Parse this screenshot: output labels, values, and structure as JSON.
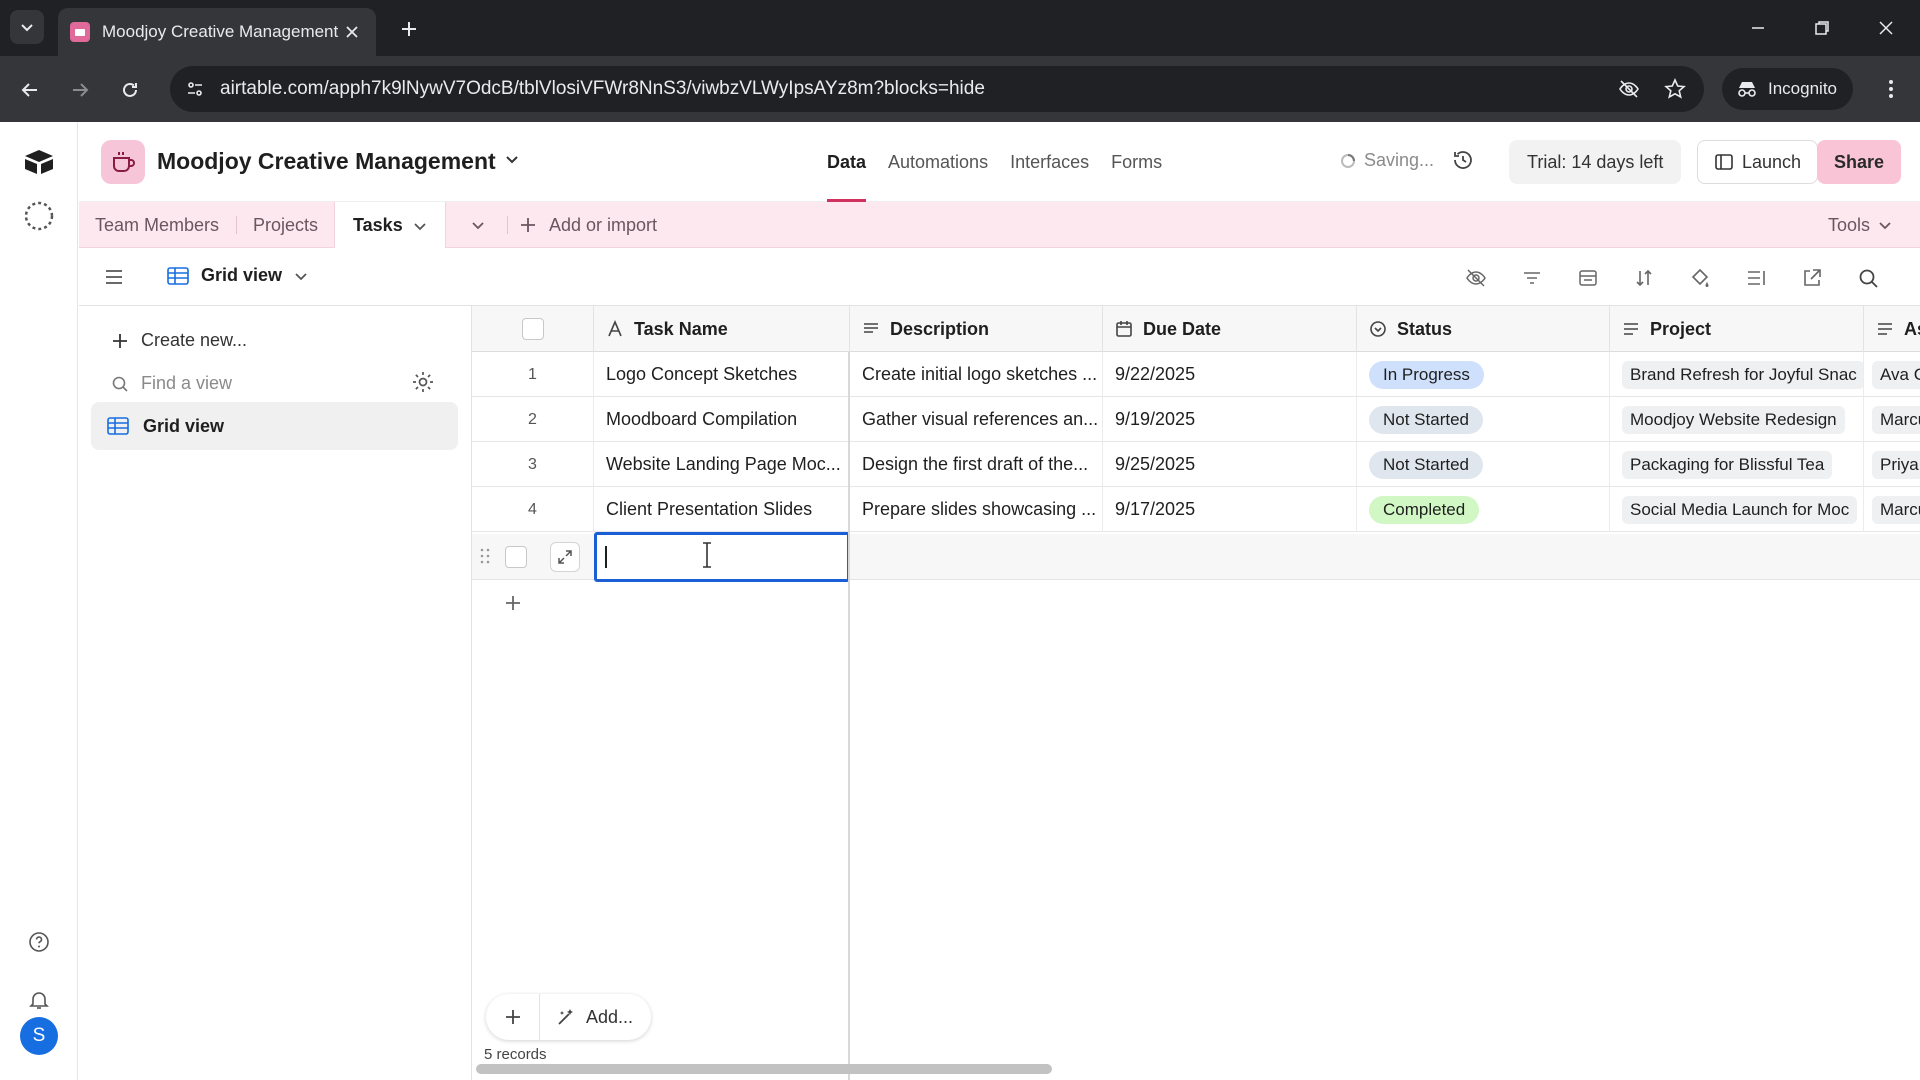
{
  "browser": {
    "tab_title": "Moodjoy Creative Management",
    "url": "airtable.com/apph7k9lNywV7OdcB/tblVlosiVFWr8NnS3/viwbzVLWyIpsAYz8m?blocks=hide",
    "incognito_label": "Incognito"
  },
  "base": {
    "name": "Moodjoy Creative Management",
    "brand_color": "#d0315e"
  },
  "topnav": [
    "Data",
    "Automations",
    "Interfaces",
    "Forms"
  ],
  "header": {
    "saving": "Saving...",
    "trial": "Trial: 14 days left",
    "launch": "Launch",
    "share": "Share"
  },
  "tables": [
    "Team Members",
    "Projects",
    "Tasks"
  ],
  "tablebar": {
    "add_import": "Add or import",
    "tools": "Tools"
  },
  "view": {
    "name": "Grid view"
  },
  "sidebar": {
    "create_new": "Create new...",
    "find_placeholder": "Find a view",
    "views": [
      "Grid view"
    ]
  },
  "columns": [
    "Task Name",
    "Description",
    "Due Date",
    "Status",
    "Project",
    "As"
  ],
  "rows": [
    {
      "num": "1",
      "task": "Logo Concept Sketches",
      "desc": "Create initial logo sketches ...",
      "due": "9/22/2025",
      "status": "In Progress",
      "project": "Brand Refresh for Joyful Snac",
      "assignee": "Ava C"
    },
    {
      "num": "2",
      "task": "Moodboard Compilation",
      "desc": "Gather visual references an...",
      "due": "9/19/2025",
      "status": "Not Started",
      "project": "Moodjoy Website Redesign",
      "assignee": "Marcu"
    },
    {
      "num": "3",
      "task": "Website Landing Page Moc...",
      "desc": "Design the first draft of the...",
      "due": "9/25/2025",
      "status": "Not Started",
      "project": "Packaging for Blissful Tea",
      "assignee": "Priya"
    },
    {
      "num": "4",
      "task": "Client Presentation Slides",
      "desc": "Prepare slides showcasing ...",
      "due": "9/17/2025",
      "status": "Completed",
      "project": "Social Media Launch for Moc",
      "assignee": "Marcu"
    }
  ],
  "status_colors": {
    "In Progress": "#cfe0fc",
    "Not Started": "#dfe6ee",
    "Completed": "#d1f7c4"
  },
  "footer": {
    "add_label": "Add...",
    "records": "5 records"
  }
}
